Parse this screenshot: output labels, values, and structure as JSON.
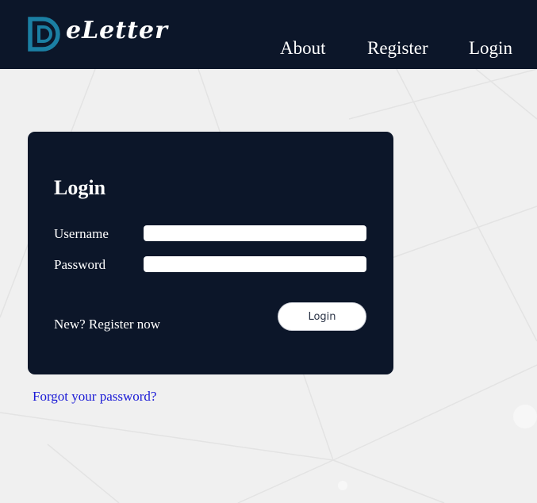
{
  "header": {
    "logo_text": "eLetter",
    "nav": {
      "about": "About",
      "register": "Register",
      "login": "Login"
    }
  },
  "login_form": {
    "title": "Login",
    "username_label": "Username",
    "username_value": "",
    "password_label": "Password",
    "password_value": "",
    "register_prompt": "New? Register now",
    "submit_label": "Login"
  },
  "forgot_password": "Forgot your password?",
  "colors": {
    "navbar": "#0c1629",
    "card": "#0c1629",
    "logo_accent": "#1b7fa3",
    "page_background": "#f0f0f0",
    "link": "#1a1ad6"
  }
}
